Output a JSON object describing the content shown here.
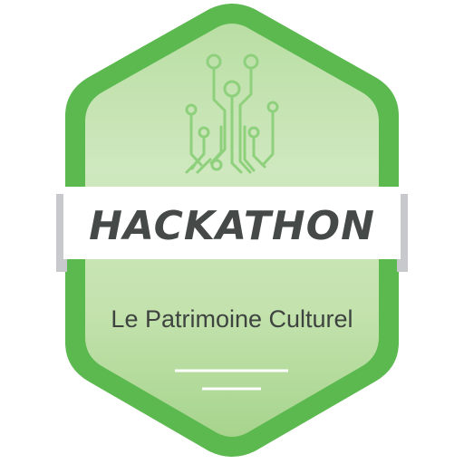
{
  "badge": {
    "title": "HACKATHON",
    "subtitle": "Le Patrimoine Culturel",
    "icon": "circuit-icon"
  },
  "colors": {
    "border": "#5bb94f",
    "inner_light": "#e5f3dc",
    "inner_mid": "#b8dea0",
    "circuit": "#8fd07d",
    "banner": "#ffffff",
    "banner_edge": "#c8c9cd",
    "text": "#454a48",
    "divider": "#ffffff"
  }
}
